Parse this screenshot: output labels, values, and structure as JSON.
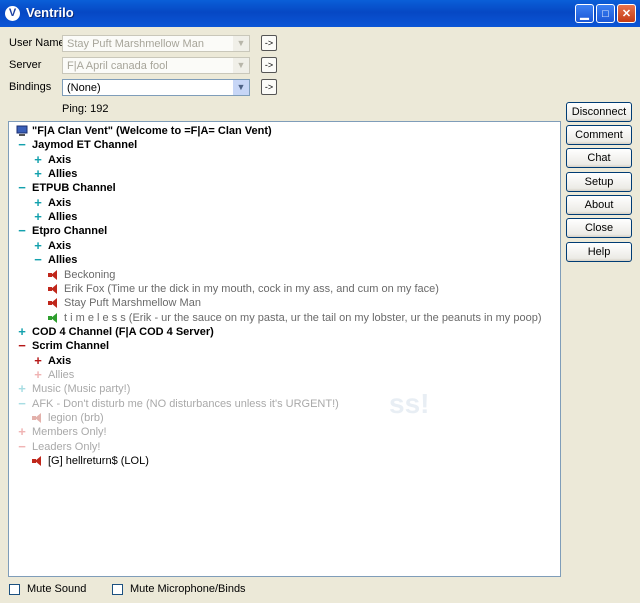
{
  "window": {
    "title": "Ventrilo",
    "min_glyph": "▁",
    "max_glyph": "□",
    "close_glyph": "✕"
  },
  "form": {
    "user_name_label": "User Name",
    "user_name_value": "Stay Puft Marshmellow Man",
    "server_label": "Server",
    "server_value": "F|A April canada fool",
    "bindings_label": "Bindings",
    "bindings_value": "(None)",
    "go_label": "->",
    "dropdown_glyph": "▼",
    "ping_text": "Ping: 192"
  },
  "buttons": [
    "Disconnect",
    "Comment",
    "Chat",
    "Setup",
    "About",
    "Close",
    "Help"
  ],
  "tree": [
    {
      "text": "\"F|A Clan Vent\" (Welcome to =F|A= Clan Vent)",
      "icon": "server",
      "depth": 0,
      "style": "bold"
    },
    {
      "text": "Jaymod ET Channel",
      "icon": "minus",
      "depth": 0,
      "style": "bold",
      "color": "cyan"
    },
    {
      "text": "Axis",
      "icon": "plus",
      "depth": 1,
      "style": "bold",
      "color": "cyan"
    },
    {
      "text": "Allies",
      "icon": "plus",
      "depth": 1,
      "style": "bold",
      "color": "cyan"
    },
    {
      "text": "ETPUB Channel",
      "icon": "minus",
      "depth": 0,
      "style": "bold",
      "color": "cyan"
    },
    {
      "text": "Axis",
      "icon": "plus",
      "depth": 1,
      "style": "bold",
      "color": "cyan"
    },
    {
      "text": "Allies",
      "icon": "plus",
      "depth": 1,
      "style": "bold",
      "color": "cyan"
    },
    {
      "text": "Etpro Channel",
      "icon": "minus",
      "depth": 0,
      "style": "bold",
      "color": "cyan"
    },
    {
      "text": "Axis",
      "icon": "plus",
      "depth": 1,
      "style": "bold",
      "color": "cyan"
    },
    {
      "text": "Allies",
      "icon": "minus",
      "depth": 1,
      "style": "bold",
      "color": "cyan"
    },
    {
      "text": "Beckoning",
      "icon": "speaker",
      "depth": 2,
      "style": "light"
    },
    {
      "text": "Erik Fox (Time ur the dick in my mouth, cock in my ass, and cum on my face)",
      "icon": "speaker",
      "depth": 2,
      "style": "light"
    },
    {
      "text": "Stay Puft Marshmellow Man",
      "icon": "speaker",
      "depth": 2,
      "style": "light"
    },
    {
      "text": "t i m e l e s s (Erik - ur the sauce on my pasta, ur the tail on my lobster, ur the peanuts in my poop)",
      "icon": "speaker-green",
      "depth": 2,
      "style": "light"
    },
    {
      "text": "COD 4 Channel (F|A COD 4 Server)",
      "icon": "plus",
      "depth": 0,
      "style": "bold",
      "color": "cyan"
    },
    {
      "text": "Scrim Channel",
      "icon": "minus",
      "depth": 0,
      "style": "bold",
      "color": "red"
    },
    {
      "text": "Axis",
      "icon": "plus",
      "depth": 1,
      "style": "bold",
      "color": "red"
    },
    {
      "text": "Allies",
      "icon": "plus",
      "depth": 1,
      "style": "faded",
      "color": "faded"
    },
    {
      "text": "Music (Music party!)",
      "icon": "plus",
      "depth": 0,
      "style": "faded",
      "color": "faded-cyan"
    },
    {
      "text": "AFK - Don't disturb me (NO disturbances unless it's URGENT!)",
      "icon": "minus",
      "depth": 0,
      "style": "faded",
      "color": "faded-cyan"
    },
    {
      "text": "legion (brb)",
      "icon": "speaker-faded",
      "depth": 1,
      "style": "faded"
    },
    {
      "text": "Members Only!",
      "icon": "plus",
      "depth": 0,
      "style": "faded",
      "color": "faded"
    },
    {
      "text": "Leaders Only!",
      "icon": "minus",
      "depth": 0,
      "style": "faded",
      "color": "faded"
    },
    {
      "text": "[G] hellreturn$ (LOL)",
      "icon": "speaker",
      "depth": 1,
      "style": "normal"
    }
  ],
  "checkboxes": [
    "Mute Sound",
    "Mute Microphone/Binds"
  ],
  "watermark": "ss!"
}
